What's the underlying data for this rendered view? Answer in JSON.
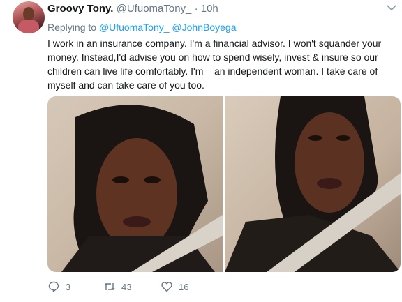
{
  "tweet": {
    "display_name": "Groovy Tony.",
    "handle": "@UfuomaTony_",
    "separator": "·",
    "time": "10h",
    "replying_prefix": "Replying to",
    "replying_to": [
      "@UfuomaTony_",
      "@JohnBoyega"
    ],
    "text": "I work in an insurance company. I'm a financial advisor. I won't squander your money. Instead,I'd advise you on how to spend wisely, invest & insure so our children can live life comfortably. I'm    an independent woman. I take care of myself and can take care of you too.",
    "actions": {
      "replies": "3",
      "retweets": "43",
      "likes": "16"
    }
  },
  "icons": {
    "menu": "chevron-down-icon",
    "reply": "reply-icon",
    "retweet": "retweet-icon",
    "like": "heart-icon"
  },
  "colors": {
    "link": "#1da1f2",
    "secondary_text": "#657786",
    "primary_text": "#14171a"
  }
}
